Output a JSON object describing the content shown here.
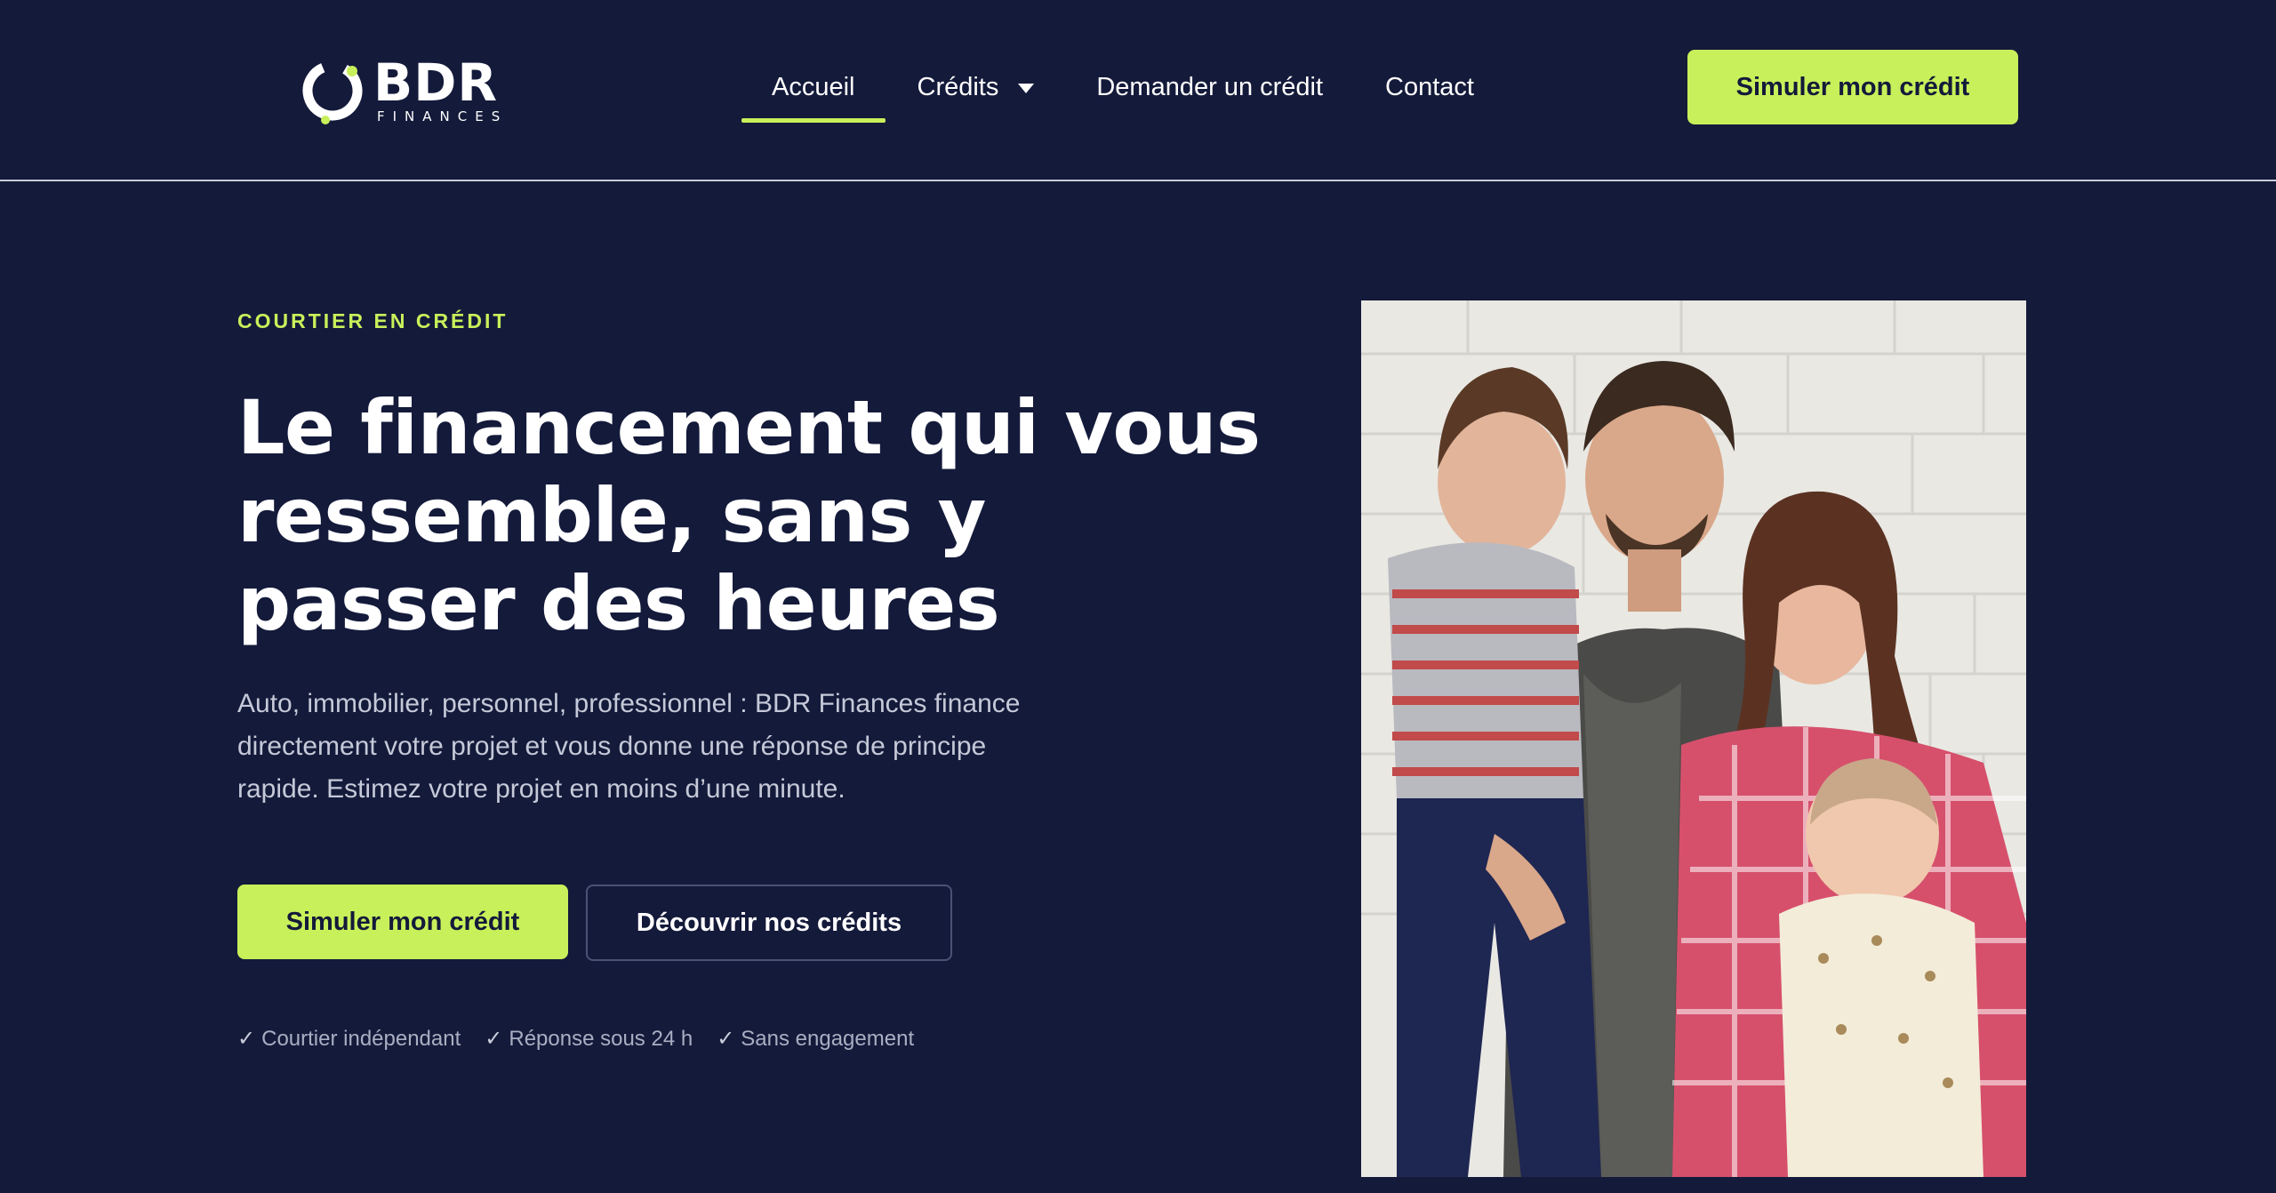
{
  "header": {
    "logo": {
      "word": "BDR",
      "sub": "FINANCES"
    },
    "nav": [
      {
        "label": "Accueil",
        "active": true
      },
      {
        "label": "Crédits",
        "has_dropdown": true
      },
      {
        "label": "Demander un crédit"
      },
      {
        "label": "Contact"
      }
    ],
    "cta_label": "Simuler mon crédit"
  },
  "hero": {
    "eyebrow": "COURTIER EN CRÉDIT",
    "title": "Le financement qui vous ressemble, sans y passer des heures",
    "text": "Auto, immobilier, personnel, professionnel : BDR Finances finance directement votre projet et vous donne une réponse de principe rapide. Estimez votre projet en moins d’une minute.",
    "primary_cta": "Simuler mon crédit",
    "secondary_cta": "Découvrir nos crédits",
    "badges": [
      "Courtier indépendant",
      "Réponse sous 24 h",
      "Sans engagement"
    ],
    "check_symbol": "✓"
  },
  "colors": {
    "background": "#141a3a",
    "accent": "#c8f05a",
    "muted_text": "#c5c9d8",
    "badge_text": "#a9aec2"
  },
  "icons": {
    "logo": "bdr-logo-mark",
    "dropdown": "chevron-down-icon",
    "check": "check-icon"
  }
}
